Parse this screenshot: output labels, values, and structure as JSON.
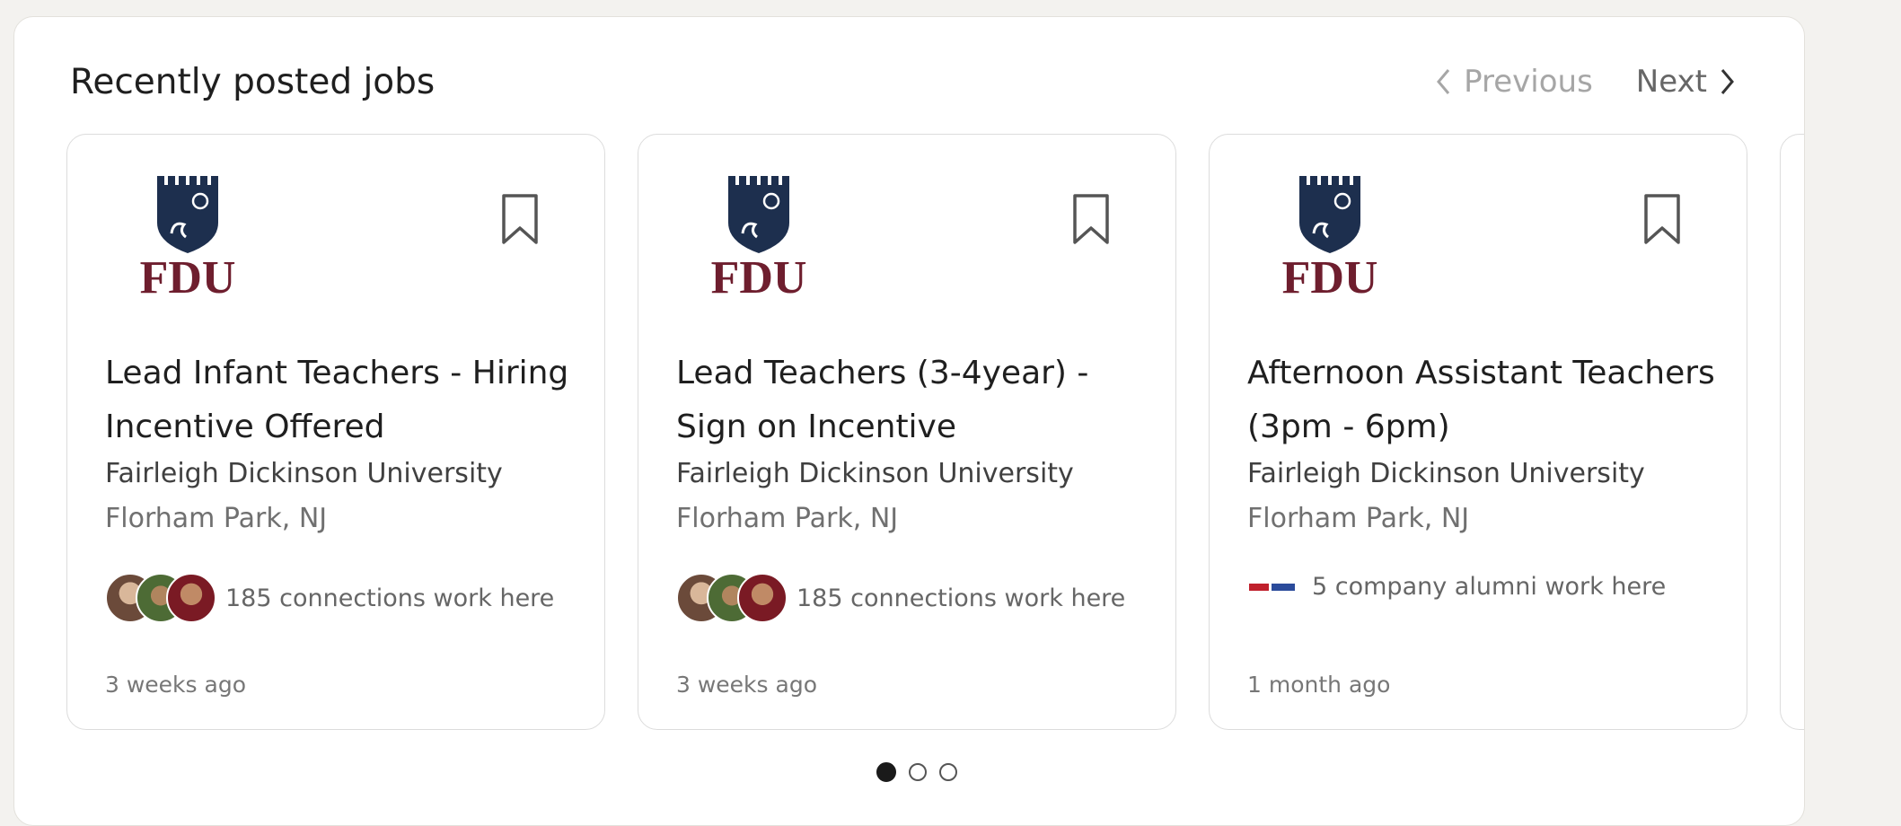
{
  "section": {
    "title": "Recently posted jobs",
    "previous_label": "Previous",
    "next_label": "Next"
  },
  "jobs": [
    {
      "logo_text": "FDU",
      "title": "Lead Infant Teachers - Hiring Incentive Offered",
      "company": "Fairleigh Dickinson University",
      "location": "Florham Park, NJ",
      "insight_type": "connections",
      "insight": "185 connections work here",
      "posted": "3 weeks ago"
    },
    {
      "logo_text": "FDU",
      "title": "Lead Teachers (3-4year) - Sign on Incentive",
      "company": "Fairleigh Dickinson University",
      "location": "Florham Park, NJ",
      "insight_type": "connections",
      "insight": "185 connections work here",
      "posted": "3 weeks ago"
    },
    {
      "logo_text": "FDU",
      "title": "Afternoon Assistant Teachers (3pm - 6pm)",
      "company": "Fairleigh Dickinson University",
      "location": "Florham Park, NJ",
      "insight_type": "alumni",
      "insight": "5 company alumni work here",
      "posted": "1 month ago"
    }
  ],
  "pagination": {
    "total_pages": 3,
    "active_page": 1
  },
  "colors": {
    "logo_shield": "#1d2f4e",
    "logo_text": "#6e1e2e",
    "alumni_logo_red": "#c0202c",
    "alumni_logo_blue": "#2b4b9b"
  },
  "icons": [
    "chevron-left-icon",
    "chevron-right-icon",
    "bookmark-icon",
    "fdu-logo",
    "avatar",
    "rwjbh-logo"
  ]
}
